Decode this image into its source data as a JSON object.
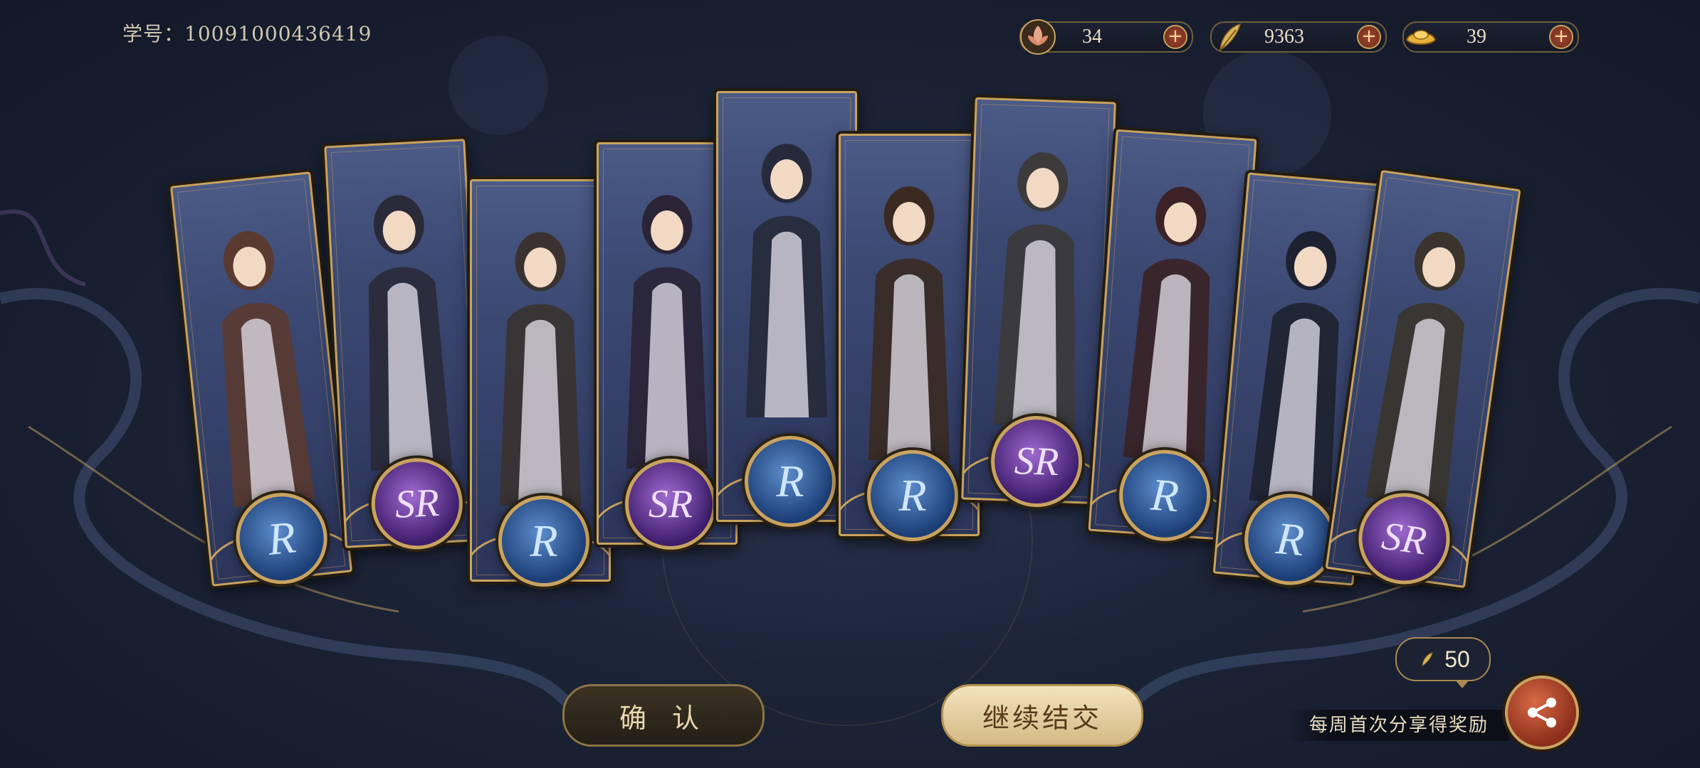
{
  "header": {
    "student_id": "学号：10091000436419"
  },
  "resources": [
    {
      "name": "lotus",
      "icon": "lotus-icon",
      "value": "34"
    },
    {
      "name": "feather",
      "icon": "feather-icon",
      "value": "9363"
    },
    {
      "name": "ingot",
      "icon": "gold-ingot-icon",
      "value": "39"
    }
  ],
  "cards": [
    {
      "rarity": "R"
    },
    {
      "rarity": "SR"
    },
    {
      "rarity": "R"
    },
    {
      "rarity": "SR"
    },
    {
      "rarity": "R"
    },
    {
      "rarity": "R"
    },
    {
      "rarity": "SR"
    },
    {
      "rarity": "R"
    },
    {
      "rarity": "R"
    },
    {
      "rarity": "SR"
    }
  ],
  "buttons": {
    "confirm_label": "确 认",
    "continue_label": "继续结交"
  },
  "share": {
    "reward_value": "50",
    "reward_icon": "feather-icon",
    "text": "每周首次分享得奖励"
  },
  "colors": {
    "gold": "#c9a35f",
    "r_medal": "#2f5ea3",
    "sr_medal": "#6b3aa0",
    "accent_red": "#b5482c"
  }
}
